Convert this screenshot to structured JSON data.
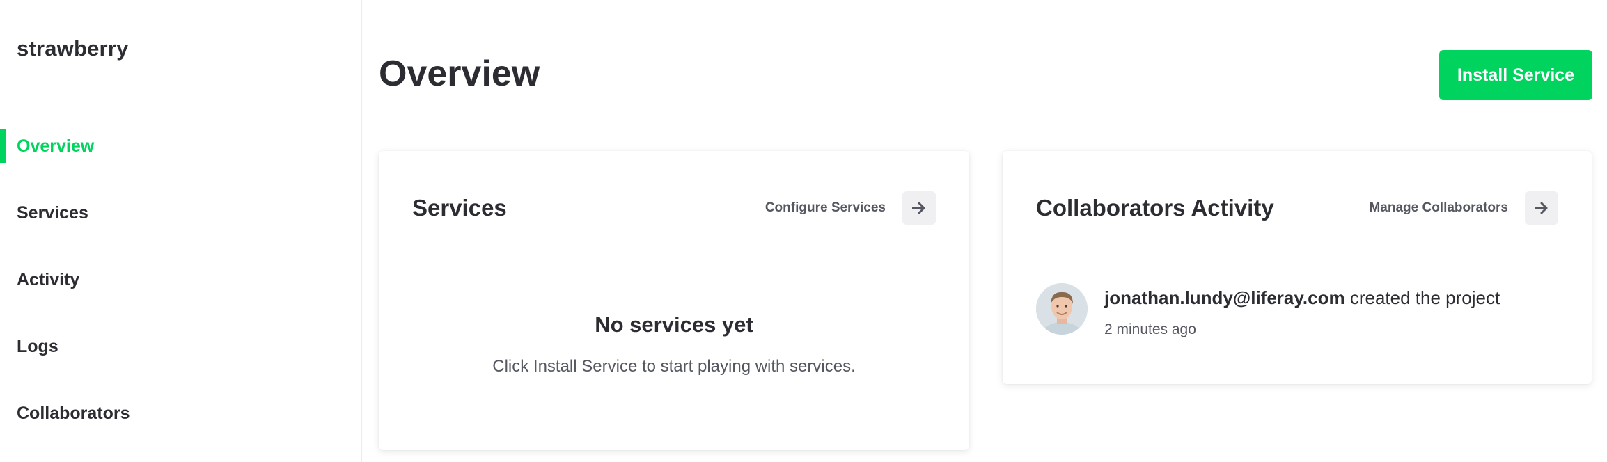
{
  "brand": "strawberry",
  "nav": {
    "items": [
      {
        "label": "Overview",
        "active": true
      },
      {
        "label": "Services",
        "active": false
      },
      {
        "label": "Activity",
        "active": false
      },
      {
        "label": "Logs",
        "active": false
      },
      {
        "label": "Collaborators",
        "active": false
      }
    ]
  },
  "page": {
    "title": "Overview",
    "install_button": "Install Service"
  },
  "services_card": {
    "title": "Services",
    "action_label": "Configure Services",
    "action_icon": "arrow-right-icon",
    "empty_title": "No services yet",
    "empty_desc": "Click Install Service to start playing with services."
  },
  "collab_card": {
    "title": "Collaborators Activity",
    "action_label": "Manage Collaborators",
    "action_icon": "arrow-right-icon",
    "activity": {
      "user": "jonathan.lundy@liferay.com",
      "action": "created the project",
      "time": "2 minutes ago"
    }
  },
  "colors": {
    "accent": "#00d45e",
    "text": "#2b2d33",
    "muted": "#555861"
  }
}
